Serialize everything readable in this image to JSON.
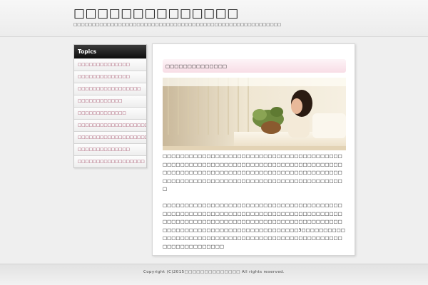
{
  "header": {
    "site_title": "□□□□□□□□□□□□□□",
    "site_description": "□□□□□□□□□□□□□□□□□□□□□□□□□□□□□□□□□□□□□□□□□□□□□□□□□□□□□□□□"
  },
  "sidebar": {
    "heading": "Topics",
    "items": [
      {
        "label": "□□□□□□□□□□□□□□"
      },
      {
        "label": "□□□□□□□□□□□□□□"
      },
      {
        "label": "□□□□□□□□□□□□□□□□□"
      },
      {
        "label": "□□□□□□□□□□□□"
      },
      {
        "label": "□□□□□□□□□□□□□"
      },
      {
        "label": "□□□□□□□□□□□□□□□□□□□"
      },
      {
        "label": "□□□□□□□□□□□□□□□□□□□□□"
      },
      {
        "label": "□□□□□□□□□□□□□□"
      },
      {
        "label": "□□□□□□□□□□□□□□□□□□"
      }
    ]
  },
  "post": {
    "title": "□□□□□□□□□□□□□□",
    "paragraph_1": "□□□□□□□□□□□□□□□□□□□□□□□□□□□□□□□□□□□□□□□□□□□□□□□□□□□□□□□□□□□□□□□□□□□□□□□□□□□□□□□□□□□□□□□□□□□□□□□□□□□□□□□□□□□□□□□□□□□□□□□□□□□□□□□□□□□□□□□□□□□□□□□□□□□□□□□□□□□□□□□□□□□□□",
    "paragraph_2": "□□□□□□□□□□□□□□□□□□□□□□□□□□□□□□□□□□□□□□□□□□□□□□□□□□□□□□□□□□□□□□□□□□□□□□□□□□□□□□□□□□□□□□□□□□□□□□□□□□□□□□□□□□□□□□□□□□□□□□□□□□□□□□□□□□□□□□□□□□□□□□□□□□□□□□□□□□3□□□□□□□□□□□□□□□□□□□□□□□□□□□□□□□□□□□□□□□□□□□□□□□□□□□□□□□□□□□□□□□□□"
  },
  "footer": {
    "copyright": "Copyright (C)2015□□□□□□□□□□□□□□ All rights reserved."
  }
}
